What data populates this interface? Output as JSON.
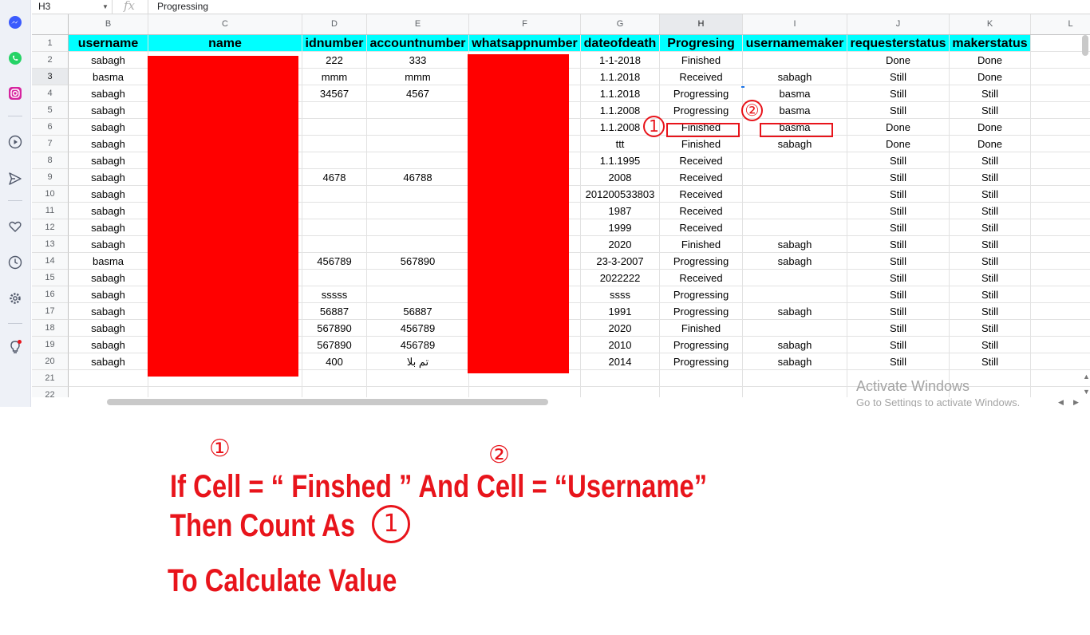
{
  "formula_bar": {
    "cell_ref": "H3",
    "fx": "fx",
    "content": "Progressing"
  },
  "columns": [
    "B",
    "C",
    "D",
    "E",
    "F",
    "G",
    "H",
    "I",
    "J",
    "K",
    "L"
  ],
  "headers": [
    "username",
    "name",
    "idnumber",
    "accountnumber",
    "whatsappnumber",
    "dateofdeath",
    "Progresing",
    "usernamemaker",
    "requesterstatus",
    "makerstatus"
  ],
  "rows": [
    {
      "n": "2",
      "c": [
        "sabagh",
        "",
        "222",
        "333",
        "",
        "1-1-2018",
        "Finished",
        "",
        "Done",
        "Done"
      ]
    },
    {
      "n": "3",
      "c": [
        "basma",
        "",
        "mmm",
        "mmm",
        "",
        "1.1.2018",
        "Received",
        "sabagh",
        "Still",
        "Done"
      ]
    },
    {
      "n": "4",
      "c": [
        "sabagh",
        "",
        "34567",
        "4567",
        "",
        "1.1.2018",
        "Progressing",
        "basma",
        "Still",
        "Still"
      ]
    },
    {
      "n": "5",
      "c": [
        "sabagh",
        "",
        "",
        "",
        "",
        "1.1.2008",
        "Progressing",
        "basma",
        "Still",
        "Still"
      ]
    },
    {
      "n": "6",
      "c": [
        "sabagh",
        "",
        "",
        "",
        "",
        "1.1.2008",
        "Finished",
        "basma",
        "Done",
        "Done"
      ]
    },
    {
      "n": "7",
      "c": [
        "sabagh",
        "",
        "",
        "",
        "",
        "ttt",
        "Finished",
        "sabagh",
        "Done",
        "Done"
      ]
    },
    {
      "n": "8",
      "c": [
        "sabagh",
        "",
        "",
        "",
        "",
        "1.1.1995",
        "Received",
        "",
        "Still",
        "Still"
      ]
    },
    {
      "n": "9",
      "c": [
        "sabagh",
        "",
        "4678",
        "46788",
        "",
        "2008",
        "Received",
        "",
        "Still",
        "Still"
      ]
    },
    {
      "n": "10",
      "c": [
        "sabagh",
        "",
        "",
        "",
        "",
        "201200533803",
        "Received",
        "",
        "Still",
        "Still"
      ]
    },
    {
      "n": "11",
      "c": [
        "sabagh",
        "",
        "",
        "",
        "",
        "1987",
        "Received",
        "",
        "Still",
        "Still"
      ]
    },
    {
      "n": "12",
      "c": [
        "sabagh",
        "",
        "",
        "",
        "",
        "1999",
        "Received",
        "",
        "Still",
        "Still"
      ]
    },
    {
      "n": "13",
      "c": [
        "sabagh",
        "",
        "",
        "",
        "",
        "2020",
        "Finished",
        "sabagh",
        "Still",
        "Still"
      ]
    },
    {
      "n": "14",
      "c": [
        "basma",
        "",
        "456789",
        "567890",
        "",
        "23-3-2007",
        "Progressing",
        "sabagh",
        "Still",
        "Still"
      ]
    },
    {
      "n": "15",
      "c": [
        "sabagh",
        "",
        "",
        "",
        "",
        "2022222",
        "Received",
        "",
        "Still",
        "Still"
      ]
    },
    {
      "n": "16",
      "c": [
        "sabagh",
        "",
        "sssss",
        "",
        "",
        "ssss",
        "Progressing",
        "",
        "Still",
        "Still"
      ]
    },
    {
      "n": "17",
      "c": [
        "sabagh",
        "",
        "56887",
        "56887",
        "",
        "1991",
        "Progressing",
        "sabagh",
        "Still",
        "Still"
      ]
    },
    {
      "n": "18",
      "c": [
        "sabagh",
        "",
        "567890",
        "456789",
        "",
        "2020",
        "Finished",
        "",
        "Still",
        "Still"
      ]
    },
    {
      "n": "19",
      "c": [
        "sabagh",
        "",
        "567890",
        "456789",
        "",
        "2010",
        "Progressing",
        "sabagh",
        "Still",
        "Still"
      ]
    },
    {
      "n": "20",
      "c": [
        "sabagh",
        "",
        "400",
        "تم بلا",
        "",
        "2014",
        "Progressing",
        "sabagh",
        "Still",
        "Still"
      ]
    }
  ],
  "empty_rows": [
    "21",
    "22"
  ],
  "header_row_num": "1",
  "colors": {
    "header_bg": "#00ffff",
    "redaction": "#ff0000",
    "annotation": "#e8141b"
  },
  "sidebar_icons": [
    "messenger-icon",
    "whatsapp-icon",
    "instagram-icon",
    "play-icon",
    "send-icon",
    "heart-icon",
    "clock-icon",
    "settings-icon",
    "lightbulb-icon"
  ],
  "watermark": {
    "line1": "Activate Windows",
    "line2": "Go to Settings to activate Windows."
  },
  "markers": {
    "one": "①",
    "two": "②",
    "one_plain": "1"
  },
  "annotation": {
    "line1": "If Cell = “ Finshed ” And Cell = “Username”",
    "line2": "Then Count As",
    "line3": "To Calculate Value"
  }
}
